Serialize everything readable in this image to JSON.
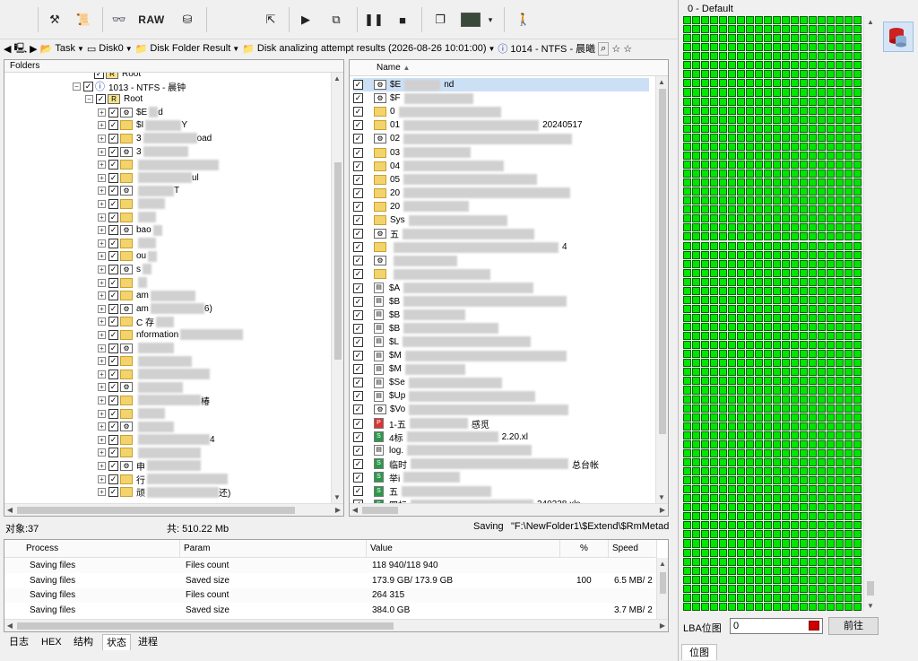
{
  "toolbar": {
    "raw_label": "RAW",
    "icons": [
      "tools-icon",
      "script-icon",
      "binoculars-icon",
      "raw-button",
      "disk-icon",
      "export-icon",
      "play-icon",
      "network-icon",
      "pause-icon",
      "stop-icon",
      "copy-icon",
      "screenshot-icon",
      "dropdown-icon",
      "exit-icon"
    ]
  },
  "address": {
    "task": "Task",
    "disk": "Disk0",
    "result": "Disk Folder Result",
    "attempt": "Disk analizing attempt results (2026-08-26 10:01:00)",
    "partition": "1014 - NTFS - 晨曦"
  },
  "folders": {
    "header": "Folders",
    "root_top": "Root",
    "partition": "1013 - NTFS - 晨钟",
    "root": "Root",
    "items": [
      "$E",
      "$I",
      "3",
      "3",
      "",
      "",
      "",
      "",
      "",
      "bao",
      "",
      "ou",
      "s",
      "",
      "am",
      "am",
      "C 存",
      "nformation",
      "",
      "",
      "",
      "",
      "",
      "",
      "",
      "",
      "",
      "申",
      "行",
      "顽"
    ],
    "item_suffix": [
      "d",
      "Y",
      "oad",
      "",
      "",
      "ul",
      "T",
      "",
      "",
      "",
      "",
      "",
      "",
      "",
      "",
      "6)",
      "",
      "",
      "",
      "",
      "",
      "",
      "椿",
      "",
      "",
      "4",
      "",
      "",
      "",
      "还)"
    ]
  },
  "files": {
    "header": "Name",
    "rows": [
      {
        "name": "$E",
        "suffix": "nd",
        "type": "sys"
      },
      {
        "name": "$F",
        "suffix": "",
        "type": "sys"
      },
      {
        "name": "0",
        "suffix": "",
        "type": "folder"
      },
      {
        "name": "01",
        "suffix": "20240517",
        "type": "folder"
      },
      {
        "name": "02",
        "suffix": "",
        "type": "sys"
      },
      {
        "name": "03",
        "suffix": "",
        "type": "folder"
      },
      {
        "name": "04",
        "suffix": "",
        "type": "folder"
      },
      {
        "name": "05",
        "suffix": "",
        "type": "folder"
      },
      {
        "name": "20",
        "suffix": "",
        "type": "folder"
      },
      {
        "name": "20",
        "suffix": "",
        "type": "folder"
      },
      {
        "name": "Sys",
        "suffix": "",
        "type": "folder"
      },
      {
        "name": "五",
        "suffix": "",
        "type": "sys"
      },
      {
        "name": "",
        "suffix": "4",
        "type": "folder"
      },
      {
        "name": "",
        "suffix": "",
        "type": "sys"
      },
      {
        "name": "",
        "suffix": "",
        "type": "folder"
      },
      {
        "name": "$A",
        "suffix": "",
        "type": "file"
      },
      {
        "name": "$B",
        "suffix": "",
        "type": "file"
      },
      {
        "name": "$B",
        "suffix": "",
        "type": "file"
      },
      {
        "name": "$B",
        "suffix": "",
        "type": "file"
      },
      {
        "name": "$L",
        "suffix": "",
        "type": "file"
      },
      {
        "name": "$M",
        "suffix": "",
        "type": "file"
      },
      {
        "name": "$M",
        "suffix": "",
        "type": "file"
      },
      {
        "name": "$Se",
        "suffix": "",
        "type": "file"
      },
      {
        "name": "$Up",
        "suffix": "",
        "type": "file"
      },
      {
        "name": "$Vo",
        "suffix": "",
        "type": "sys"
      },
      {
        "name": "1-五",
        "suffix": "感觅",
        "type": "pdf"
      },
      {
        "name": "4标",
        "suffix": "2.20.xl",
        "type": "xls"
      },
      {
        "name": "log.",
        "suffix": "",
        "type": "file"
      },
      {
        "name": "临时",
        "suffix": "总台帐",
        "type": "xls"
      },
      {
        "name": "举i",
        "suffix": "",
        "type": "xls"
      },
      {
        "name": "五",
        "suffix": "",
        "type": "xls"
      },
      {
        "name": "四标",
        "suffix": "240228.xls",
        "type": "xls"
      }
    ]
  },
  "status": {
    "objects": "对象:37",
    "total": "共: 510.22 Mb",
    "saving_label": "Saving",
    "saving_path": "\"F:\\NewFolder1\\$Extend\\$RmMetad"
  },
  "process": {
    "headers": [
      "Process",
      "Param",
      "Value",
      "%",
      "Speed"
    ],
    "rows": [
      {
        "process": "Saving files",
        "param": "Files count",
        "value": "118 940/118 940",
        "pct": "",
        "speed": ""
      },
      {
        "process": "Saving files",
        "param": "Saved size",
        "value": "173.9 GB/ 173.9 GB",
        "pct": "100",
        "speed": "6.5 MB/ 2"
      },
      {
        "process": "Saving files",
        "param": "Files count",
        "value": "264 315",
        "pct": "",
        "speed": ""
      },
      {
        "process": "Saving files",
        "param": "Saved size",
        "value": "384.0 GB",
        "pct": "",
        "speed": "3.7 MB/ 2"
      }
    ]
  },
  "tabs": [
    "日志",
    "HEX",
    "结构",
    "状态",
    "进程"
  ],
  "lba": {
    "title": "0 - Default",
    "label": "LBA位图",
    "input_value": "0",
    "go_label": "前往",
    "tab_label": "位图",
    "cell_color": "#00e600",
    "cell_border": "#006400"
  }
}
